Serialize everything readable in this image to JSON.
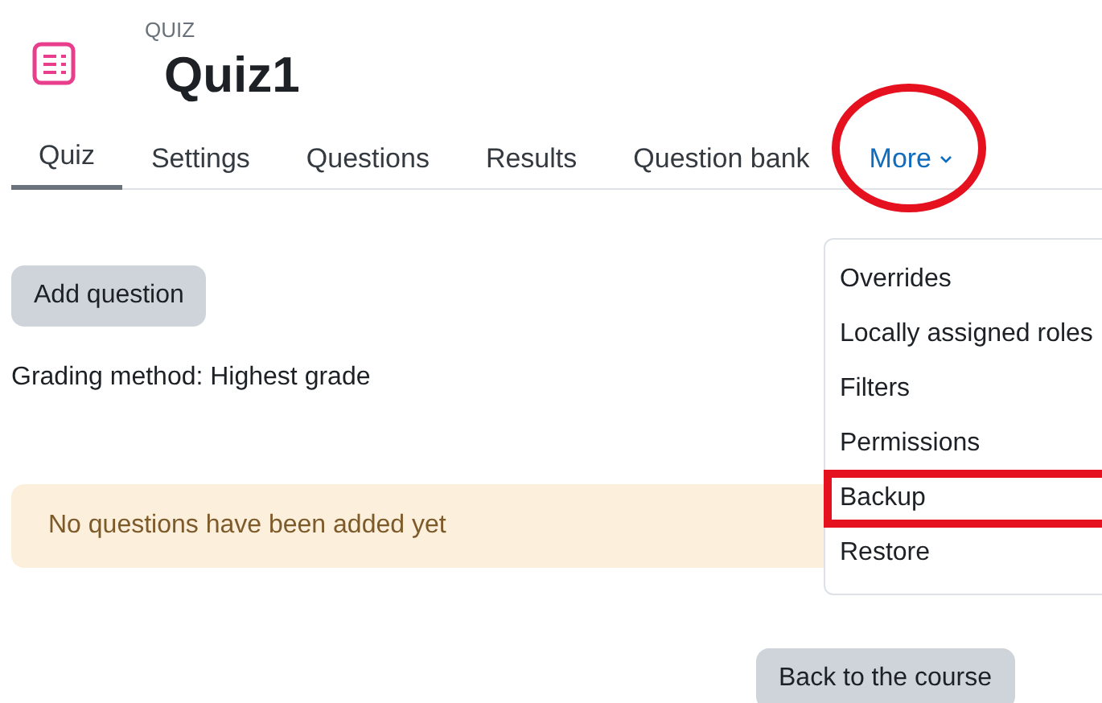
{
  "header": {
    "context": "QUIZ",
    "title": "Quiz1"
  },
  "tabs": [
    {
      "label": "Quiz",
      "selected": true,
      "annotated": false
    },
    {
      "label": "Settings",
      "selected": false,
      "annotated": false
    },
    {
      "label": "Questions",
      "selected": false,
      "annotated": false
    },
    {
      "label": "Results",
      "selected": false,
      "annotated": false
    },
    {
      "label": "Question bank",
      "selected": false,
      "annotated": false
    },
    {
      "label": "More",
      "selected": false,
      "annotated": true,
      "kind": "dropdown"
    }
  ],
  "menu": [
    {
      "label": "Overrides",
      "annotated": false
    },
    {
      "label": "Locally assigned roles",
      "annotated": false
    },
    {
      "label": "Filters",
      "annotated": false
    },
    {
      "label": "Permissions",
      "annotated": false
    },
    {
      "label": "Backup",
      "annotated": true
    },
    {
      "label": "Restore",
      "annotated": false
    }
  ],
  "add_button": "Add question",
  "grading": "Grading method: Highest grade",
  "notice": "No questions have been added yet",
  "back_button": "Back to the course"
}
